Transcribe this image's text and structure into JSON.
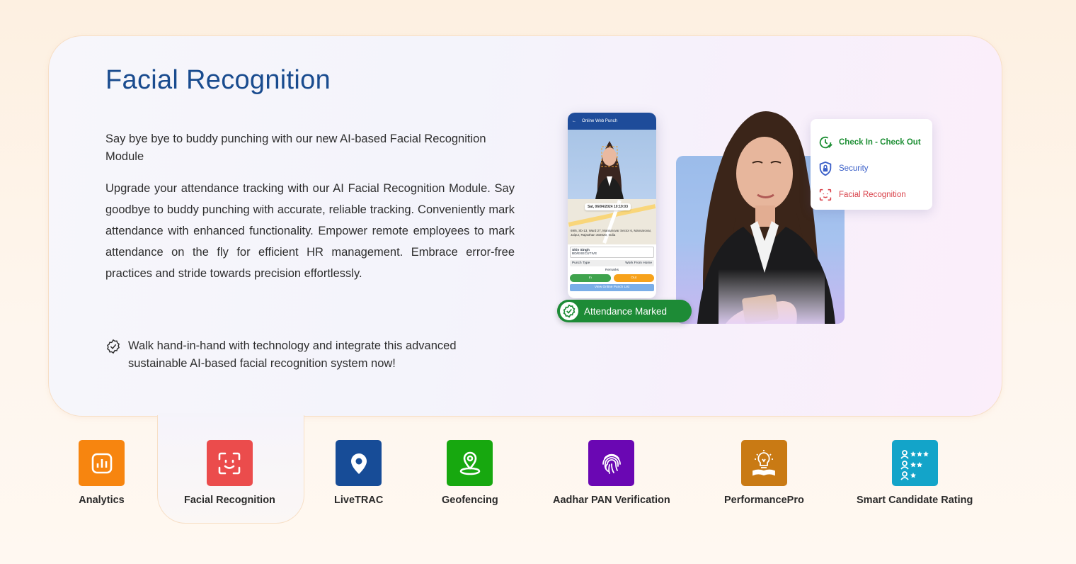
{
  "section": {
    "title": "Facial Recognition",
    "intro": "Say bye bye to buddy punching with our new AI-based Facial Recognition Module",
    "body": "Upgrade your attendance tracking with our AI Facial Recognition Module. Say goodbye to buddy punching with accurate, reliable tracking. Conveniently mark attendance with enhanced functionality. Empower remote employees to mark attendance on the fly for efficient HR management. Embrace error-free practices and stride towards precision effortlessly.",
    "tagline": "Walk hand-in-hand with technology and integrate this advanced sustainable AI-based facial recognition system now!"
  },
  "illustration": {
    "phone": {
      "header": "Online Web Punch",
      "datetime": "Sat, 06/04/2024 10:19:03",
      "address": "69/6, Sb-13, Ward 27, Mansarovar Sector 6, Mansarovar, Jaipur, Rajasthan 302020, India",
      "employee_name": "Shiv Singh",
      "employee_role": "BD/EXECUTIVE",
      "punch_type_label": "Punch Type",
      "punch_type_value": "Work From Home",
      "remarks_label": "Remarks",
      "in_label": "In",
      "out_label": "Out",
      "list_link": "View Online Punch List"
    },
    "features": [
      {
        "label": "Check In - Check Out",
        "icon": "clock-check-icon",
        "color": "#1e8f35"
      },
      {
        "label": "Security",
        "icon": "shield-lock-icon",
        "color": "#3a5fc8"
      },
      {
        "label": "Facial Recognition",
        "icon": "face-scan-icon",
        "color": "#d9434b"
      }
    ],
    "attendance_badge": "Attendance Marked"
  },
  "nav": [
    {
      "label": "Analytics",
      "icon": "bar-chart-icon",
      "color": "#f7850f"
    },
    {
      "label": "Facial Recognition",
      "icon": "face-scan-icon",
      "color": "#eb4c4c"
    },
    {
      "label": "LiveTRAC",
      "icon": "location-pin-icon",
      "color": "#174c97"
    },
    {
      "label": "Geofencing",
      "icon": "geofence-pin-icon",
      "color": "#17a80f"
    },
    {
      "label": "Aadhar PAN Verification",
      "icon": "fingerprint-icon",
      "color": "#6a07b3"
    },
    {
      "label": "PerformancePro",
      "icon": "lightbulb-book-icon",
      "color": "#c97a14"
    },
    {
      "label": "Smart Candidate Rating",
      "icon": "candidate-rating-icon",
      "color": "#13a4c9"
    }
  ],
  "nav_selected": "Facial Recognition"
}
